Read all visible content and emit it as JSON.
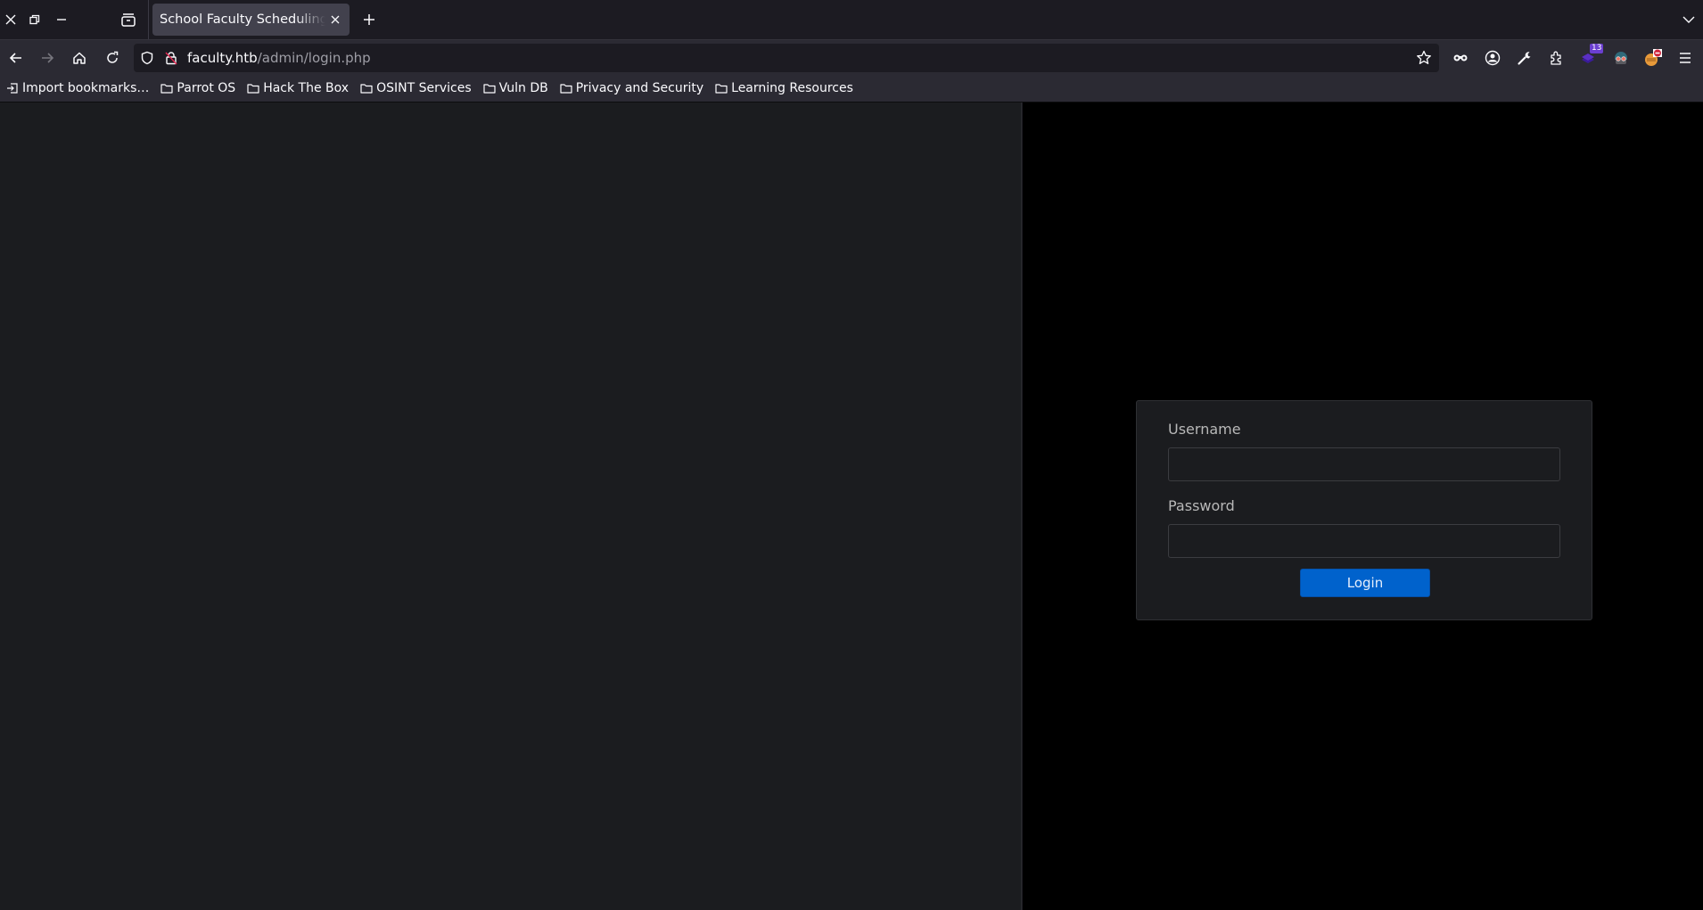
{
  "browser": {
    "tab": {
      "title": "School Faculty Scheduling System"
    },
    "url": {
      "host": "faculty.htb",
      "path": "/admin/login.php"
    },
    "extensions": {
      "badge_count": "13"
    },
    "bookmarks": [
      {
        "label": "Import bookmarks…",
        "icon": "import-icon"
      },
      {
        "label": "Parrot OS",
        "icon": "folder-icon"
      },
      {
        "label": "Hack The Box",
        "icon": "folder-icon"
      },
      {
        "label": "OSINT Services",
        "icon": "folder-icon"
      },
      {
        "label": "Vuln DB",
        "icon": "folder-icon"
      },
      {
        "label": "Privacy and Security",
        "icon": "folder-icon"
      },
      {
        "label": "Learning Resources",
        "icon": "folder-icon"
      }
    ]
  },
  "login": {
    "username_label": "Username",
    "username_value": "",
    "password_label": "Password",
    "password_value": "",
    "submit_label": "Login"
  },
  "colors": {
    "accent": "#0062cc",
    "page_left": "#1b1c1f",
    "page_right": "#000000"
  }
}
